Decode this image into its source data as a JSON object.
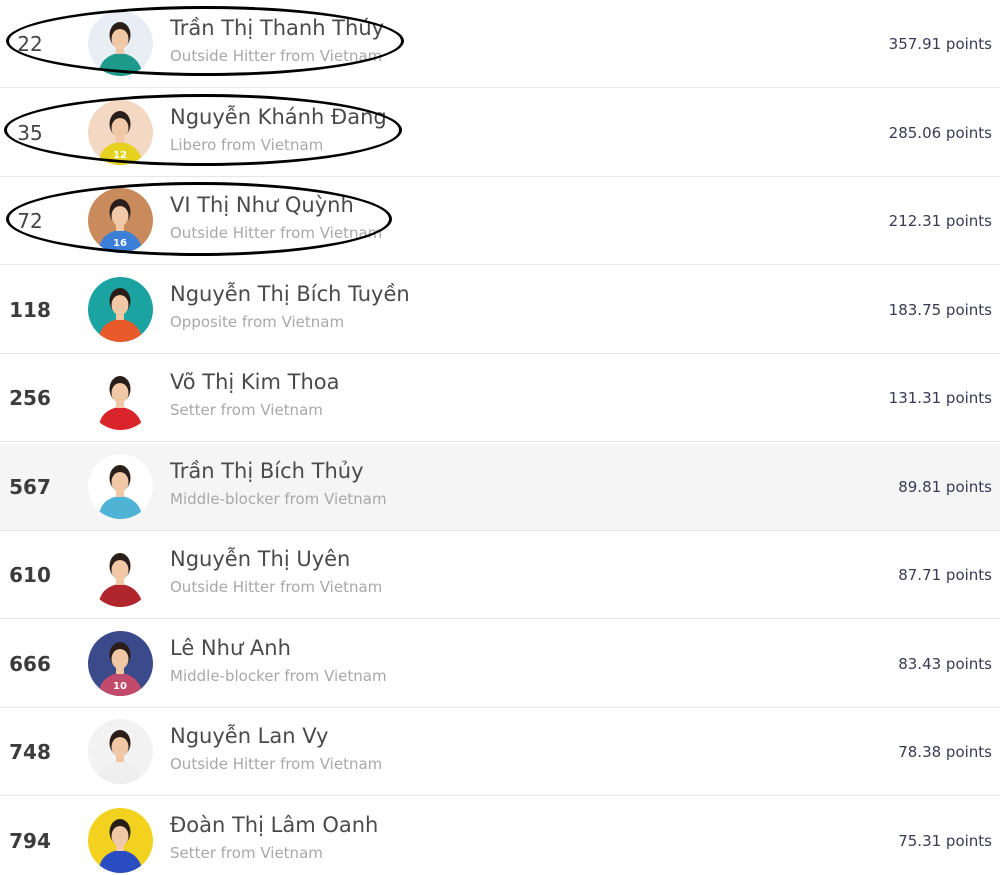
{
  "players": [
    {
      "rank": "22",
      "name": "Trần Thị Thanh Thúy",
      "role": "Outside Hitter from Vietnam",
      "points": "357.91 points",
      "jersey": "",
      "jersey_color": "#1e9a8a",
      "bg": "#e8eef4",
      "shirt": "#1e9a8a"
    },
    {
      "rank": "35",
      "name": "Nguyễn Khánh Đang",
      "role": "Libero from Vietnam",
      "points": "285.06 points",
      "jersey": "12",
      "bg": "#f3d9c4",
      "shirt": "#e6d21e"
    },
    {
      "rank": "72",
      "name": "VI Thị Như Quỳnh",
      "role": "Outside Hitter from Vietnam",
      "points": "212.31 points",
      "jersey": "16",
      "bg": "#c98a5c",
      "shirt": "#3b7fd6"
    },
    {
      "rank": "118",
      "name": "Nguyễn Thị Bích Tuyền",
      "role": "Opposite from Vietnam",
      "points": "183.75 points",
      "jersey": "",
      "bg": "#1aa3a0",
      "shirt": "#e85a2a"
    },
    {
      "rank": "256",
      "name": "Võ Thị Kim Thoa",
      "role": "Setter from Vietnam",
      "points": "131.31 points",
      "jersey": "",
      "bg": "#ffffff",
      "shirt": "#d8242a"
    },
    {
      "rank": "567",
      "name": "Trần Thị Bích Thủy",
      "role": "Middle-blocker from Vietnam",
      "points": "89.81 points",
      "jersey": "",
      "bg": "#ffffff",
      "shirt": "#4fb3d6"
    },
    {
      "rank": "610",
      "name": "Nguyễn Thị Uyên",
      "role": "Outside Hitter from Vietnam",
      "points": "87.71 points",
      "jersey": "",
      "bg": "#ffffff",
      "shirt": "#b0262c"
    },
    {
      "rank": "666",
      "name": "Lê Như Anh",
      "role": "Middle-blocker from Vietnam",
      "points": "83.43 points",
      "jersey": "10",
      "bg": "#3a4a8a",
      "shirt": "#c24a6a"
    },
    {
      "rank": "748",
      "name": "Nguyễn Lan Vy",
      "role": "Outside Hitter from Vietnam",
      "points": "78.38 points",
      "jersey": "",
      "bg": "#f2f2f2",
      "shirt": "#eeeeee"
    },
    {
      "rank": "794",
      "name": "Đoàn Thị Lâm Oanh",
      "role": "Setter from Vietnam",
      "points": "75.31 points",
      "jersey": "",
      "bg": "#f2d21e",
      "shirt": "#2a4ec2"
    }
  ],
  "highlighted_index": 5,
  "circled_indices": [
    0,
    1,
    2
  ]
}
